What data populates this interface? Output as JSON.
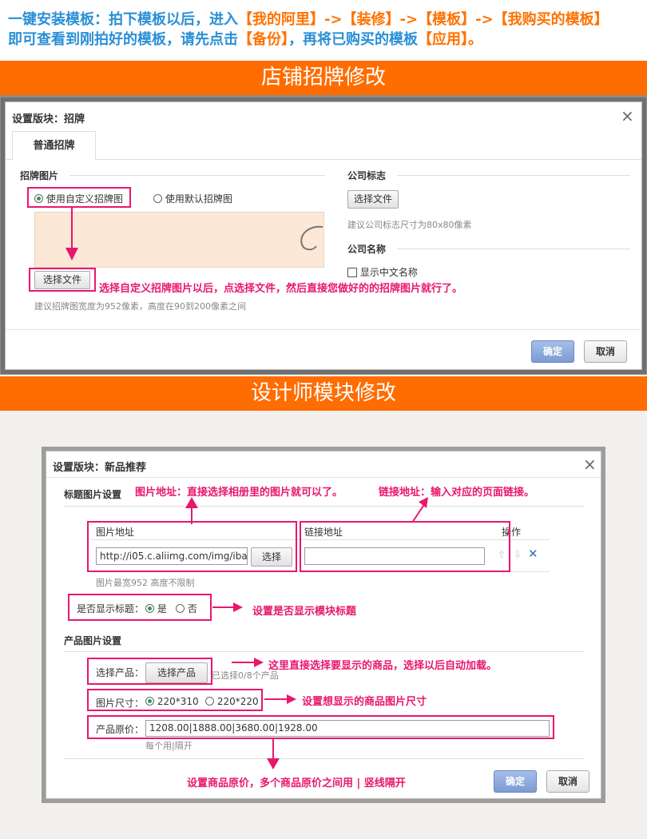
{
  "intro": {
    "line1_a": "一键安装模板：拍下模板以后，进入",
    "line1_b": "【我的阿里】->【装修】->【模板】->【我购买的模板】",
    "line2_a": "即可查看到刚拍好的模板，请先点击",
    "line2_b": "【备份】",
    "line2_c": "，再将已购买的模板",
    "line2_d": "【应用】。"
  },
  "section1": {
    "title": "店铺招牌修改",
    "dialog": {
      "title": "设置版块：招牌",
      "close": "×",
      "tab": "普通招牌",
      "left_section": "招牌图片",
      "radio_custom": "使用自定义招牌图",
      "radio_default": "使用默认招牌图",
      "choose_file": "选择文件",
      "image_hint": "建议招牌图宽度为952像素，高度在90到200像素之间",
      "logo_section": "公司标志",
      "logo_choose": "选择文件",
      "logo_hint": "建议公司标志尺寸为80x80像素",
      "name_section": "公司名称",
      "show_cn_name": "显示中文名称",
      "ok": "确定",
      "cancel": "取消"
    },
    "annotation": "选择自定义招牌图片以后，点选择文件，然后直接您做好的的招牌图片就行了。"
  },
  "section2": {
    "title": "设计师模块修改",
    "dialog": {
      "title": "设置版块：新品推荐",
      "close": "×",
      "title_image_section": "标题图片设置",
      "col_image_url": "图片地址",
      "col_link_url": "链接地址",
      "col_ops": "操作",
      "image_url_value": "http://i05.c.aliimg.com/img/ibank",
      "select_btn": "选择",
      "link_value": "",
      "image_hint": "图片最宽952 高度不限制",
      "show_title_label": "是否显示标题：",
      "yes": "是",
      "no": "否",
      "product_section": "产品图片设置",
      "select_product_label": "选择产品：",
      "select_product_btn": "选择产品",
      "selected_count": "已选择0/8个产品",
      "image_size_label": "图片尺寸：",
      "size_a": "220*310",
      "size_b": "220*220",
      "price_label": "产品原价：",
      "price_value": "1208.00|1888.00|3680.00|1928.00",
      "price_hint": "每个用|隔开",
      "ok": "确定",
      "cancel": "取消"
    },
    "annotations": {
      "image_url": "图片地址：直接选择相册里的图片就可以了。",
      "link_url": "链接地址：输入对应的页面链接。",
      "show_title": "设置是否显示模块标题",
      "select_product": "这里直接选择要显示的商品，选择以后自动加载。",
      "image_size": "设置想显示的商品图片尺寸",
      "price": "设置商品原价，多个商品原价之间用 | 竖线隔开"
    }
  },
  "colors": {
    "orange_bar": "#ff6c00",
    "intro_blue": "#2a8fd6",
    "intro_orange": "#ff7200",
    "annotation": "#e8176e",
    "radio_green": "#2b9b4d"
  }
}
